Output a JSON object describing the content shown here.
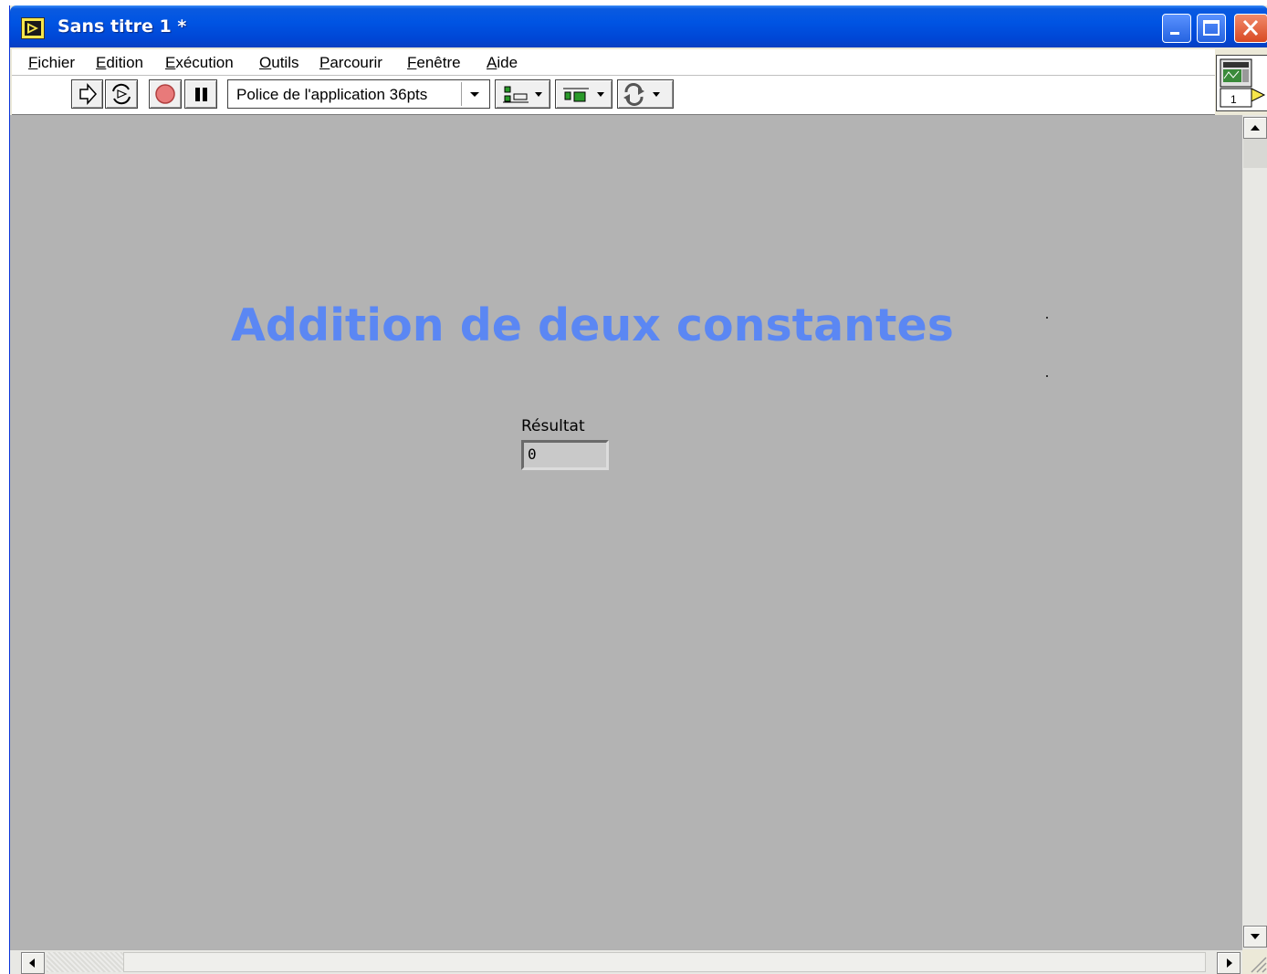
{
  "window": {
    "title": "Sans titre 1 *"
  },
  "menu": {
    "items": [
      "Fichier",
      "Edition",
      "Exécution",
      "Outils",
      "Parcourir",
      "Fenêtre",
      "Aide"
    ]
  },
  "toolbar": {
    "font_selector_value": "Police de l'application 36pts"
  },
  "panel": {
    "title": "Addition de deux constantes",
    "indicator": {
      "label": "Résultat",
      "value": "0"
    }
  },
  "vi_icon": {
    "number": "1"
  },
  "colors": {
    "title_bar": "#0054e3",
    "panel_background": "#b3b3b3",
    "title_text": "#5b87f3"
  }
}
